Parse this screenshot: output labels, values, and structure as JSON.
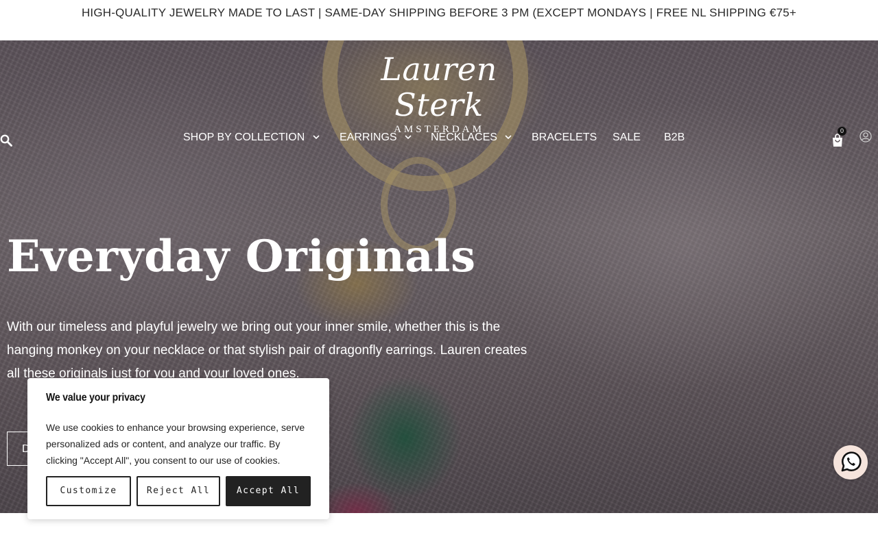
{
  "announcement": {
    "text": "HIGH-QUALITY JEWELRY MADE TO LAST | SAME-DAY SHIPPING BEFORE 3 PM (EXCEPT MONDAYS | FREE NL SHIPPING €75+"
  },
  "logo": {
    "name": "Lauren Sterk",
    "city": "AMSTERDAM"
  },
  "nav": {
    "items": [
      {
        "label": "SHOP BY COLLECTION",
        "dropdown": true
      },
      {
        "label": "EARRINGS",
        "dropdown": true
      },
      {
        "label": "NECKLACES",
        "dropdown": true
      },
      {
        "label": "BRACELETS",
        "dropdown": false
      },
      {
        "label": "SALE",
        "dropdown": false
      },
      {
        "label": "B2B",
        "dropdown": false
      }
    ],
    "cart_count": "0",
    "icons": [
      "search-icon",
      "cart-icon",
      "account-icon"
    ]
  },
  "hero": {
    "title": "Everyday Originals",
    "text": "With our timeless and playful jewelry we bring out your inner smile, whether this is the hanging monkey on your necklace or that stylish pair of dragonfly earrings. Lauren creates all these originals just for you and your loved ones.",
    "button_label": "D"
  },
  "cookie": {
    "title": "We value your privacy",
    "text": "We use cookies to enhance your browsing experience, serve personalized ads or content, and analyze our traffic. By clicking \"Accept All\", you consent to our use of cookies.",
    "buttons": {
      "customize": "Customize",
      "reject": "Reject All",
      "accept": "Accept All"
    }
  },
  "colors": {
    "dark_button": "#222222",
    "whatsapp_bg": "#f6e4dc"
  }
}
